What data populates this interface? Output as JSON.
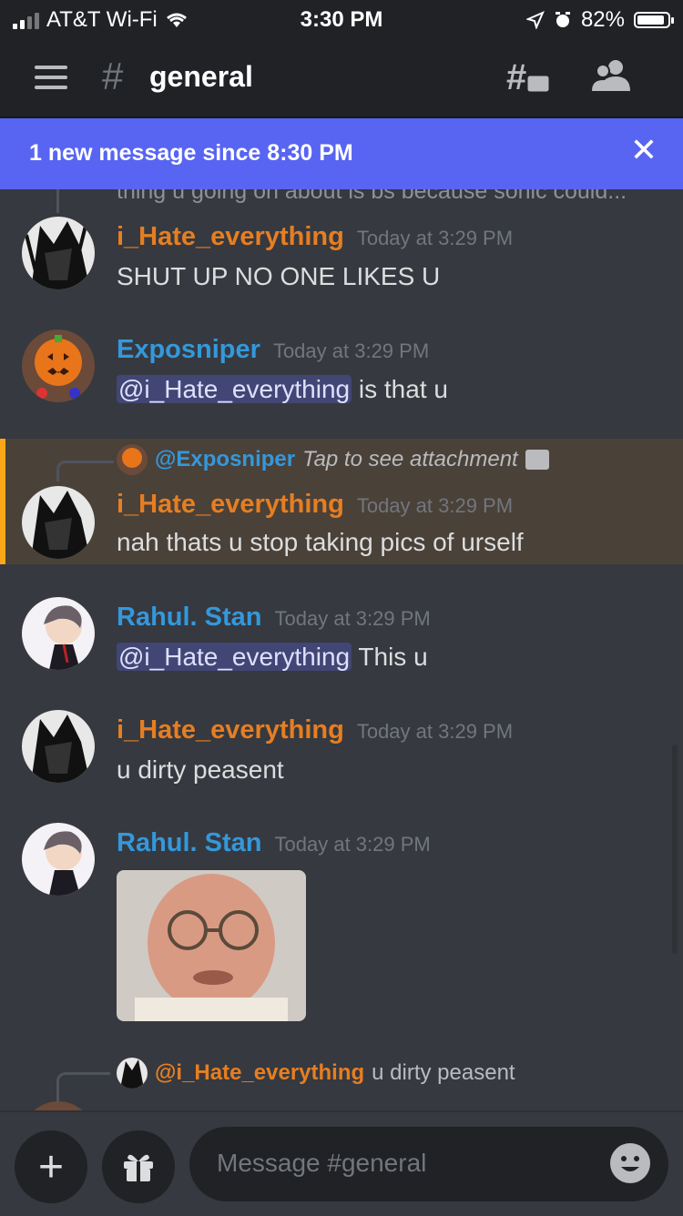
{
  "status_bar": {
    "carrier": "AT&T Wi-Fi",
    "time": "3:30 PM",
    "battery": "82%",
    "battery_level": 0.82
  },
  "header": {
    "channel_hash": "#",
    "channel_name": "general"
  },
  "banner": {
    "text": "1 new message since 8:30 PM",
    "close_label": "✕"
  },
  "feed": {
    "faded_text": "thing u going on about is bs because sonic could...",
    "messages": [
      {
        "author": "i_Hate_everything",
        "timestamp": "Today at 3:29 PM",
        "text": "SHUT UP NO ONE LIKES U"
      },
      {
        "author": "Exposniper",
        "timestamp": "Today at 3:29 PM",
        "mention": "@i_Hate_everything",
        "text": " is that u"
      },
      {
        "reply_to": "@Exposniper",
        "reply_text": "Tap to see attachment",
        "author": "i_Hate_everything",
        "timestamp": "Today at 3:29 PM",
        "text": "nah thats u stop taking pics of urself"
      },
      {
        "author": "Rahul. Stan",
        "timestamp": "Today at 3:29 PM",
        "mention": "@i_Hate_everything",
        "text": " This u"
      },
      {
        "author": "i_Hate_everything",
        "timestamp": "Today at 3:29 PM",
        "text": "u dirty peasent"
      },
      {
        "author": "Rahul. Stan",
        "timestamp": "Today at 3:29 PM"
      },
      {
        "reply_to": "@i_Hate_everything",
        "reply_text": "u dirty peasent"
      }
    ]
  },
  "composer": {
    "placeholder": "Message #general",
    "plus_label": "+"
  },
  "colors": {
    "background": "#36393f",
    "header": "#202225",
    "banner": "#5865f2",
    "orange_name": "#e67e22",
    "blue_name": "#3498db",
    "highlight": "#4a4139",
    "highlight_bar": "#faa81a"
  }
}
